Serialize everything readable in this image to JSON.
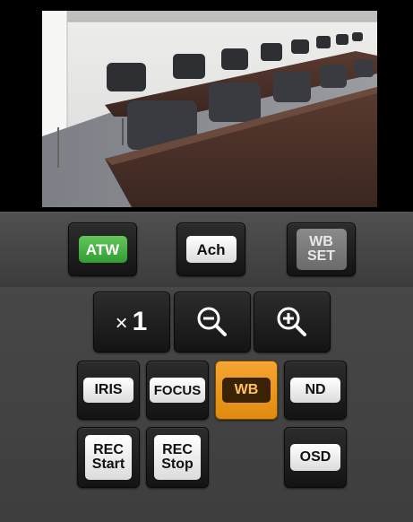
{
  "wb_bar": {
    "atw_label": "ATW",
    "ach_label": "Ach",
    "wb_set_line1": "WB",
    "wb_set_line2": "SET"
  },
  "zoom": {
    "multiplier_symbol": "×",
    "multiplier_value": "1",
    "zoom_out_icon": "magnifier-minus-icon",
    "zoom_in_icon": "magnifier-plus-icon"
  },
  "modes": {
    "iris_label": "IRIS",
    "focus_label": "FOCUS",
    "wb_label": "WB",
    "nd_label": "ND"
  },
  "record": {
    "rec_start_line1": "REC",
    "rec_start_line2": "Start",
    "rec_stop_line1": "REC",
    "rec_stop_line2": "Stop",
    "osd_label": "OSD"
  },
  "colors": {
    "active_orange": "#f39a1c",
    "atw_green": "#46b04a"
  }
}
